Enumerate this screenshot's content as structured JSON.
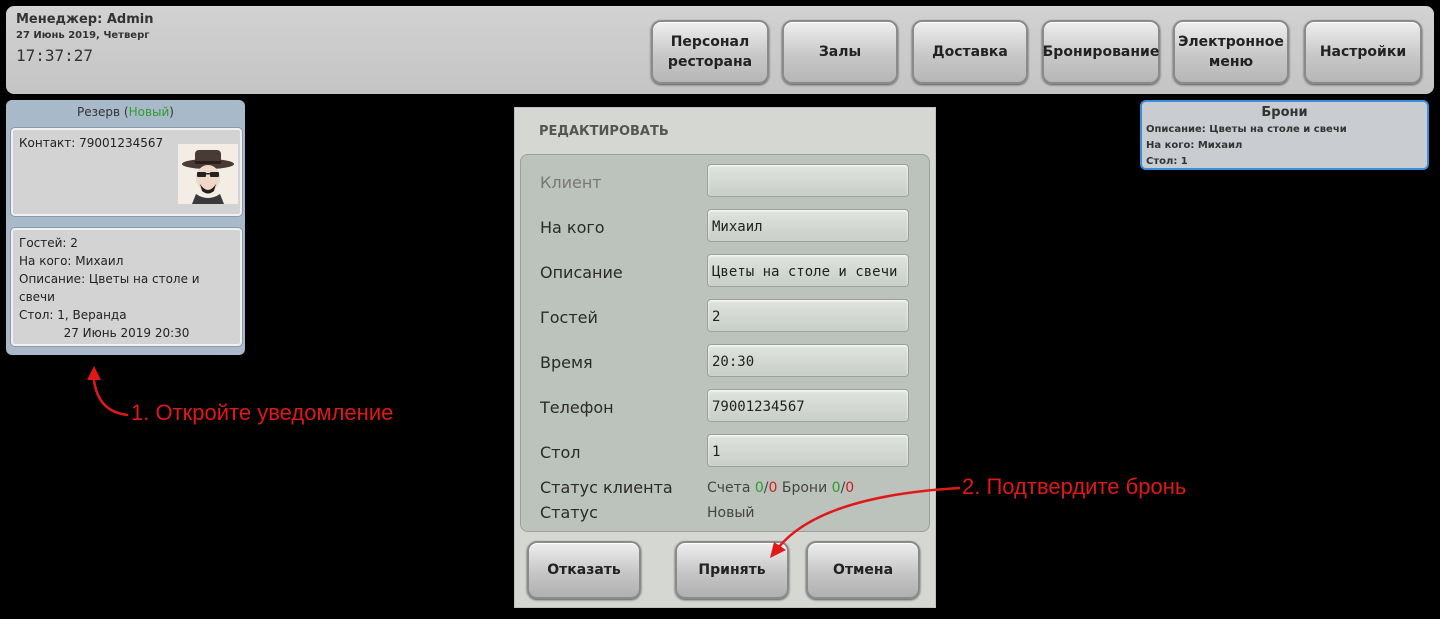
{
  "header": {
    "manager": "Менеджер: Admin",
    "date": "27 Июнь 2019, Четверг",
    "time": "17:37:27",
    "nav": [
      "Персонал\nресторана",
      "Залы",
      "Доставка",
      "Бронирование",
      "Электронное\nменю",
      "Настройки"
    ]
  },
  "notification": {
    "title_prefix": "Резерв (",
    "status": "Новый",
    "title_suffix": ")",
    "contact": "Контакт: 79001234567",
    "guests": "Гостей: 2",
    "for_whom": "На кого: Михаил",
    "description": "Описание: Цветы на столе и свечи",
    "table": "Стол: 1, Веранда",
    "datetime": "27 Июнь 2019 20:30"
  },
  "annotations": {
    "step1": "1. Откройте уведомление",
    "step2": "2. Подтвердите бронь"
  },
  "dialog": {
    "title": "РЕДАКТИРОВАТЬ",
    "fields": [
      {
        "label": "Клиент",
        "value": ""
      },
      {
        "label": "На кого",
        "value": "Михаил"
      },
      {
        "label": "Описание",
        "value": "Цветы на столе и свечи"
      },
      {
        "label": "Гостей",
        "value": "2"
      },
      {
        "label": "Время",
        "value": "20:30"
      },
      {
        "label": "Телефон",
        "value": "79001234567"
      },
      {
        "label": "Стол",
        "value": "1"
      }
    ],
    "client_status_label": "Статус клиента",
    "client_status": {
      "accounts_label": "Счета ",
      "accounts_ok": "0",
      "accounts_bad": "0",
      "bookings_label": " Брони ",
      "bookings_ok": "0",
      "bookings_bad": "0"
    },
    "status_label": "Статус",
    "status_value": "Новый",
    "buttons": {
      "decline": "Отказать",
      "accept": "Принять",
      "cancel": "Отмена"
    }
  },
  "bookings_panel": {
    "title": "Брони",
    "description": "Описание: Цветы на столе и свечи",
    "for_whom": "На кого: Михаил",
    "table": "Стол: 1"
  },
  "colors": {
    "accent_green": "#2e9e2e",
    "accent_red": "#d02020",
    "annotation_red": "#e01818",
    "panel_border_blue": "#3a8fdd"
  }
}
